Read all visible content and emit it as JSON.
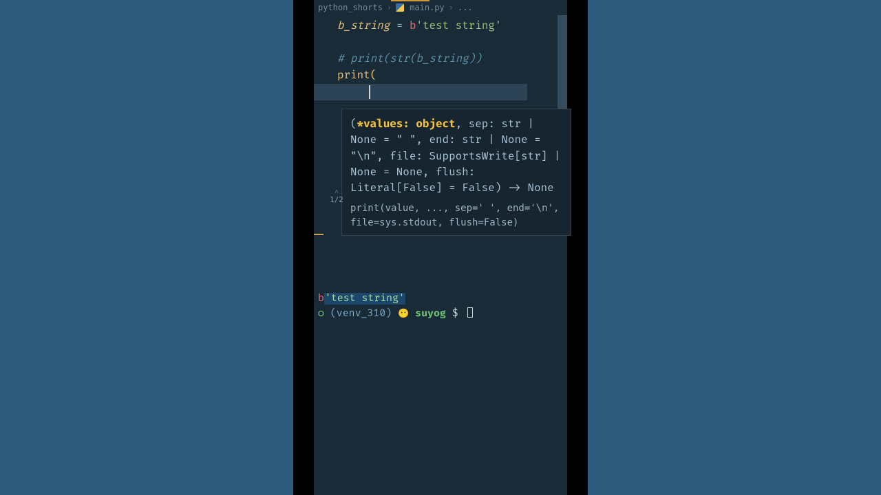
{
  "breadcrumb": {
    "folder": "python_shorts",
    "file": "main.py",
    "dots": "..."
  },
  "code": {
    "l1_var": "b_string",
    "l1_eq": " = ",
    "l1_prefix": "b",
    "l1_str": "'test string'",
    "l3_comment": "# print(str(b_string))",
    "l4_fn": "print",
    "l4_paren": "("
  },
  "tooltip": {
    "sig_open": "(",
    "sig_hl": "*values: object",
    "sig_rest": ", sep: str | None = \" \", end: str | None = \"\\n\", file: SupportsWrite[str] | None = None, flush: Literal[False] = False) -> None",
    "counter": "1/2",
    "doc": "print(value, ..., sep=' ', end='\\n', file=sys.stdout, flush=False)"
  },
  "terminal": {
    "out_prefix": "b",
    "out_str": "'test string'",
    "branch_sym": "○",
    "env": "(venv_310)",
    "emoji": "😶",
    "user": "suyog",
    "dollar": "$"
  }
}
